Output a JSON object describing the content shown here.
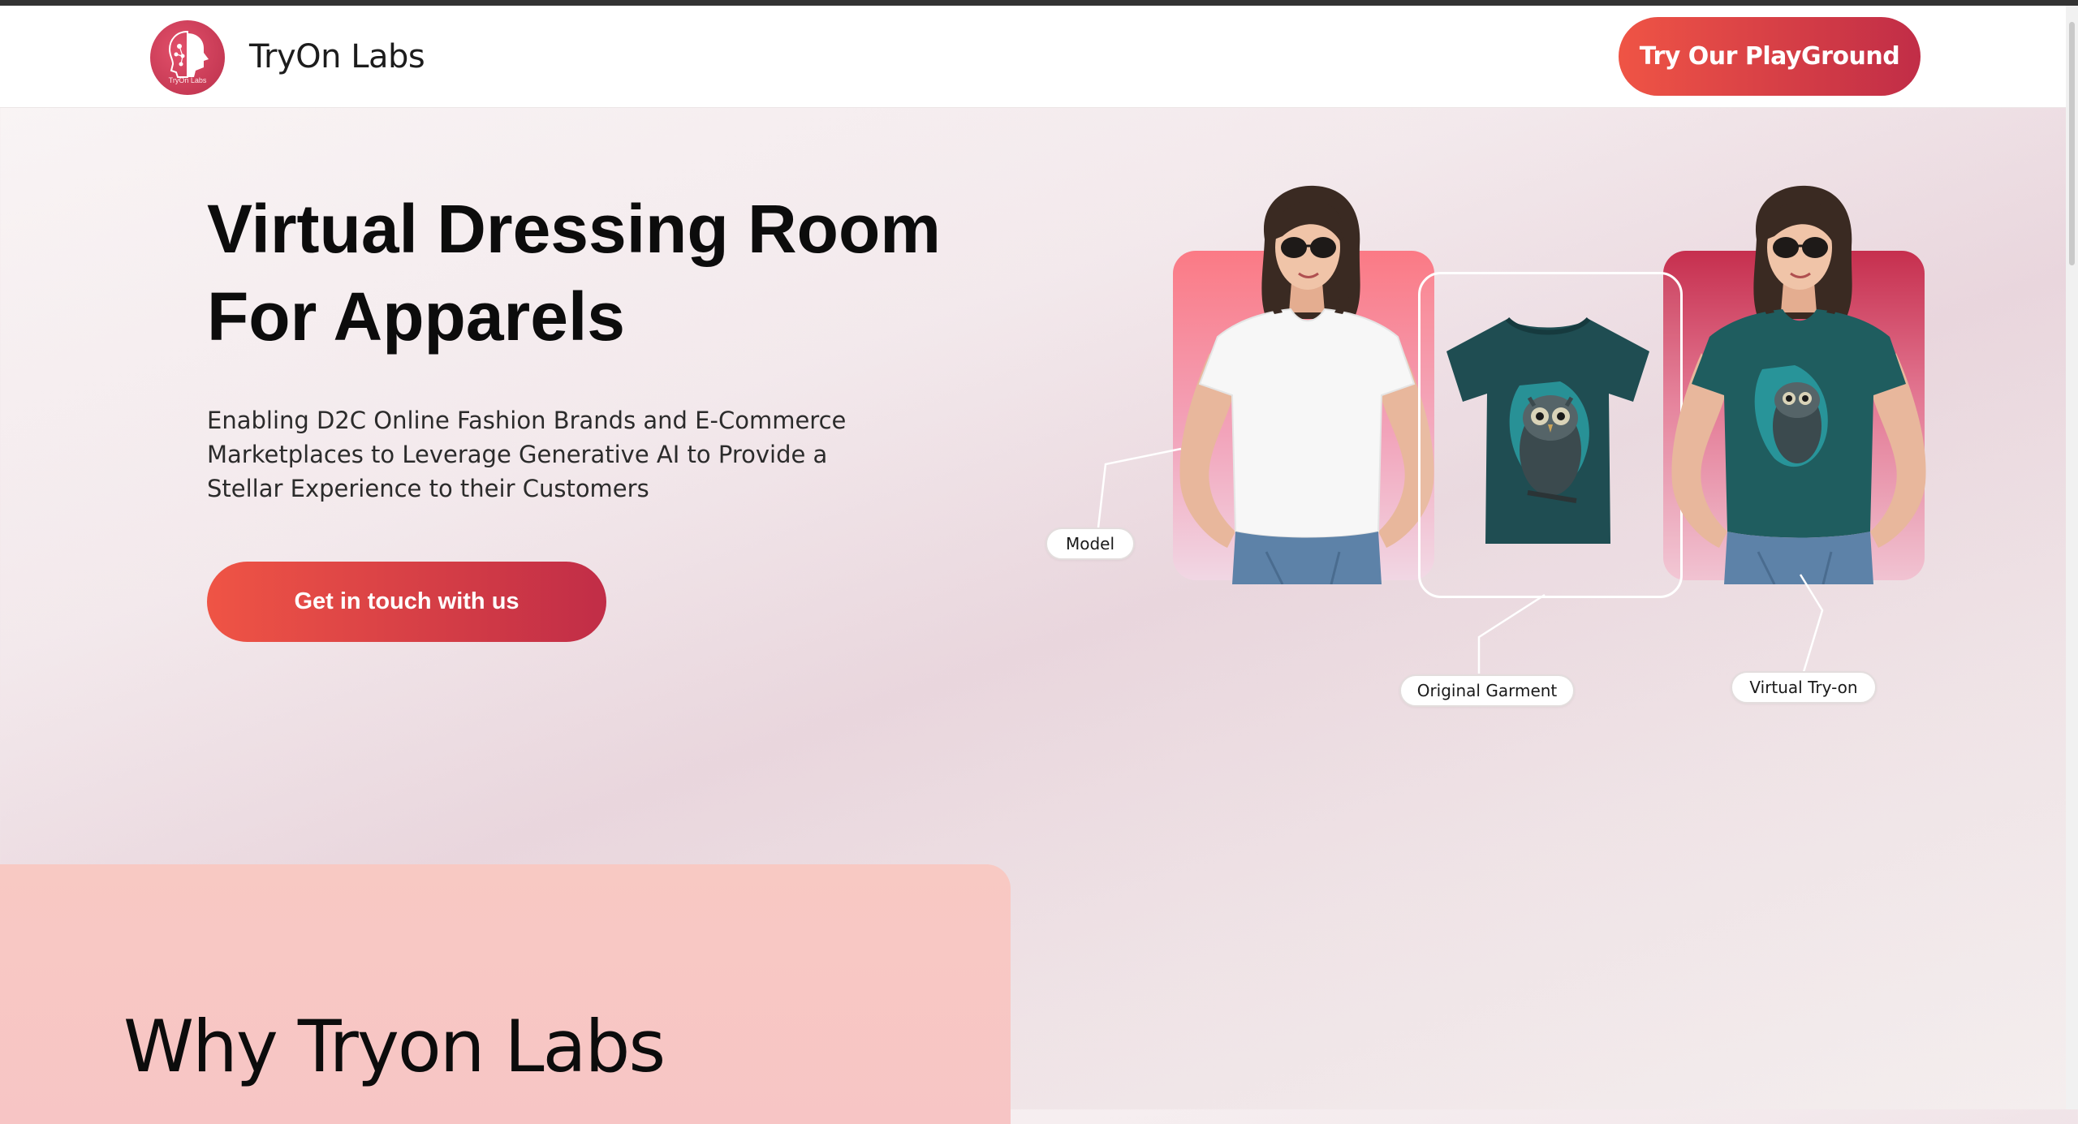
{
  "header": {
    "brand_name": "TryOn Labs",
    "logo_text": "TryOn Labs",
    "cta_label": "Try Our PlayGround"
  },
  "hero": {
    "title_line1": "Virtual Dressing Room",
    "title_line2": "For Apparels",
    "description": "Enabling D2C Online Fashion Brands and E-Commerce Marketplaces to Leverage Generative AI to Provide a Stellar Experience to their Customers",
    "cta_label": "Get in touch with us"
  },
  "showcase": {
    "labels": {
      "model": "Model",
      "garment": "Original Garment",
      "tryon": "Virtual Try-on"
    }
  },
  "why": {
    "title": "Why Tryon Labs"
  },
  "colors": {
    "accent_start": "#ef5445",
    "accent_end": "#c12d47",
    "tshirt_teal": "#1f5d5f",
    "tshirt_white": "#f7f7f7"
  },
  "icons": {
    "logo": "head-brain-icon"
  }
}
